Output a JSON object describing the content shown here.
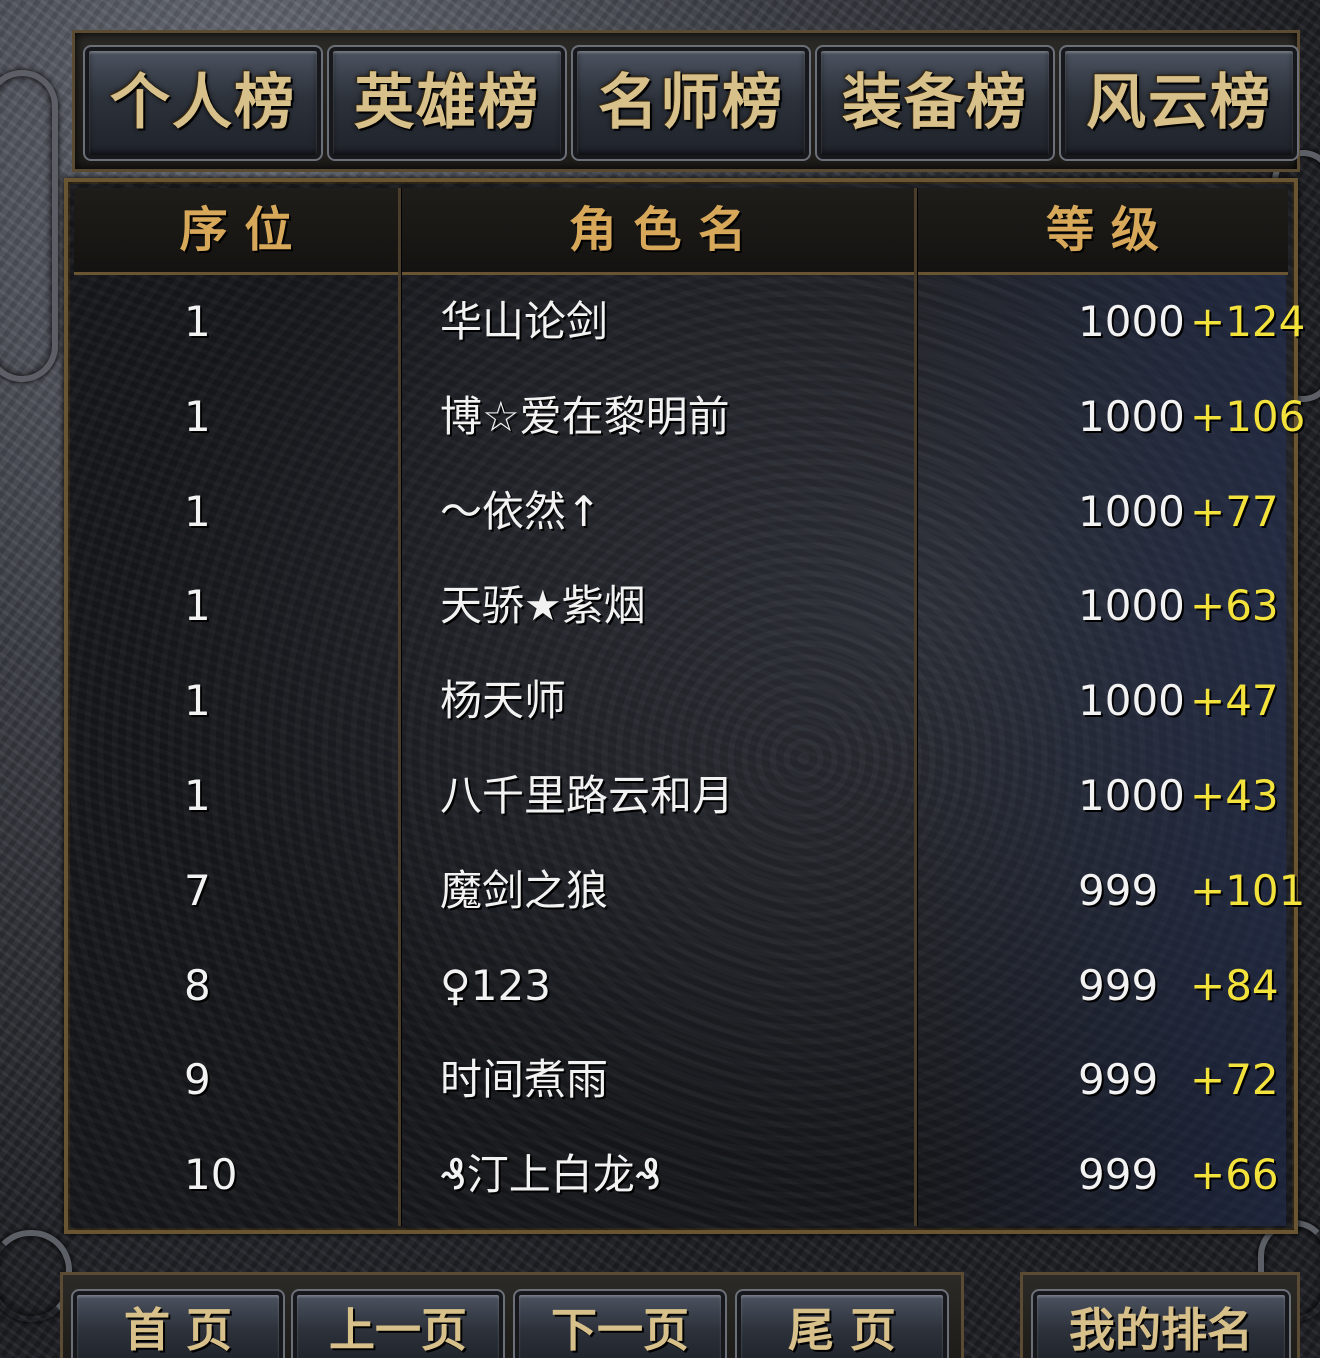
{
  "tabs": [
    {
      "label": "个人榜"
    },
    {
      "label": "英雄榜"
    },
    {
      "label": "名师榜"
    },
    {
      "label": "装备榜"
    },
    {
      "label": "风云榜"
    }
  ],
  "table": {
    "headers": {
      "rank": "序 位",
      "name": "角 色 名",
      "level": "等 级"
    },
    "rows": [
      {
        "rank": "1",
        "name": "华山论剑",
        "level": "1000",
        "bonus": "+124"
      },
      {
        "rank": "1",
        "name": "博☆爱在黎明前",
        "level": "1000",
        "bonus": "+106"
      },
      {
        "rank": "1",
        "name": "～依然↑",
        "level": "1000",
        "bonus": "+77"
      },
      {
        "rank": "1",
        "name": "天骄★紫烟",
        "level": "1000",
        "bonus": "+63"
      },
      {
        "rank": "1",
        "name": "杨天师",
        "level": "1000",
        "bonus": "+47"
      },
      {
        "rank": "1",
        "name": "八千里路云和月",
        "level": "1000",
        "bonus": "+43"
      },
      {
        "rank": "7",
        "name": "魔剑之狼",
        "level": "999",
        "bonus": "+101"
      },
      {
        "rank": "8",
        "name": "♀123",
        "level": "999",
        "bonus": "+84"
      },
      {
        "rank": "9",
        "name": "时间煮雨",
        "level": "999",
        "bonus": "+72"
      },
      {
        "rank": "10",
        "name": "₰汀上白龙₰",
        "level": "999",
        "bonus": "+66"
      }
    ]
  },
  "pagination": {
    "first": "首 页",
    "prev": "上一页",
    "next": "下一页",
    "last": "尾 页",
    "my_rank": "我的排名"
  },
  "colors": {
    "tab_text": "#d8c08a",
    "header_text": "#d7a85a",
    "row_text": "#f2f2f2",
    "bonus_text": "#f4e23c"
  }
}
